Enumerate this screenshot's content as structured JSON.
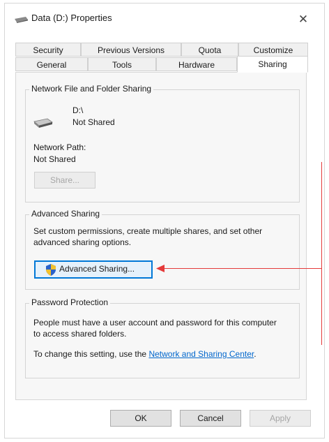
{
  "window": {
    "title": "Data (D:) Properties",
    "close_glyph": "✕"
  },
  "tabs": {
    "row1": [
      "Security",
      "Previous Versions",
      "Quota",
      "Customize"
    ],
    "row2": [
      "General",
      "Tools",
      "Hardware",
      "Sharing"
    ],
    "selected": "Sharing"
  },
  "network_sharing": {
    "group_label": "Network File and Folder Sharing",
    "drive_name": "D:\\",
    "drive_status": "Not Shared",
    "path_label": "Network Path:",
    "path_value": "Not Shared",
    "share_button": "Share..."
  },
  "advanced_sharing": {
    "group_label": "Advanced Sharing",
    "description": "Set custom permissions, create multiple shares, and set other advanced sharing options.",
    "button": "Advanced Sharing..."
  },
  "password_protection": {
    "group_label": "Password Protection",
    "description": "People must have a user account and password for this computer to access shared folders.",
    "change_prefix": "To change this setting, use the ",
    "link_text": "Network and Sharing Center",
    "change_suffix": "."
  },
  "footer": {
    "ok": "OK",
    "cancel": "Cancel",
    "apply": "Apply"
  },
  "colors": {
    "accent": "#0078d7",
    "link": "#0066cc",
    "annotation": "#e53a3a"
  },
  "icons": {
    "title": "drive-icon",
    "close": "close-icon",
    "drive": "drive-icon",
    "shield": "uac-shield-icon"
  }
}
